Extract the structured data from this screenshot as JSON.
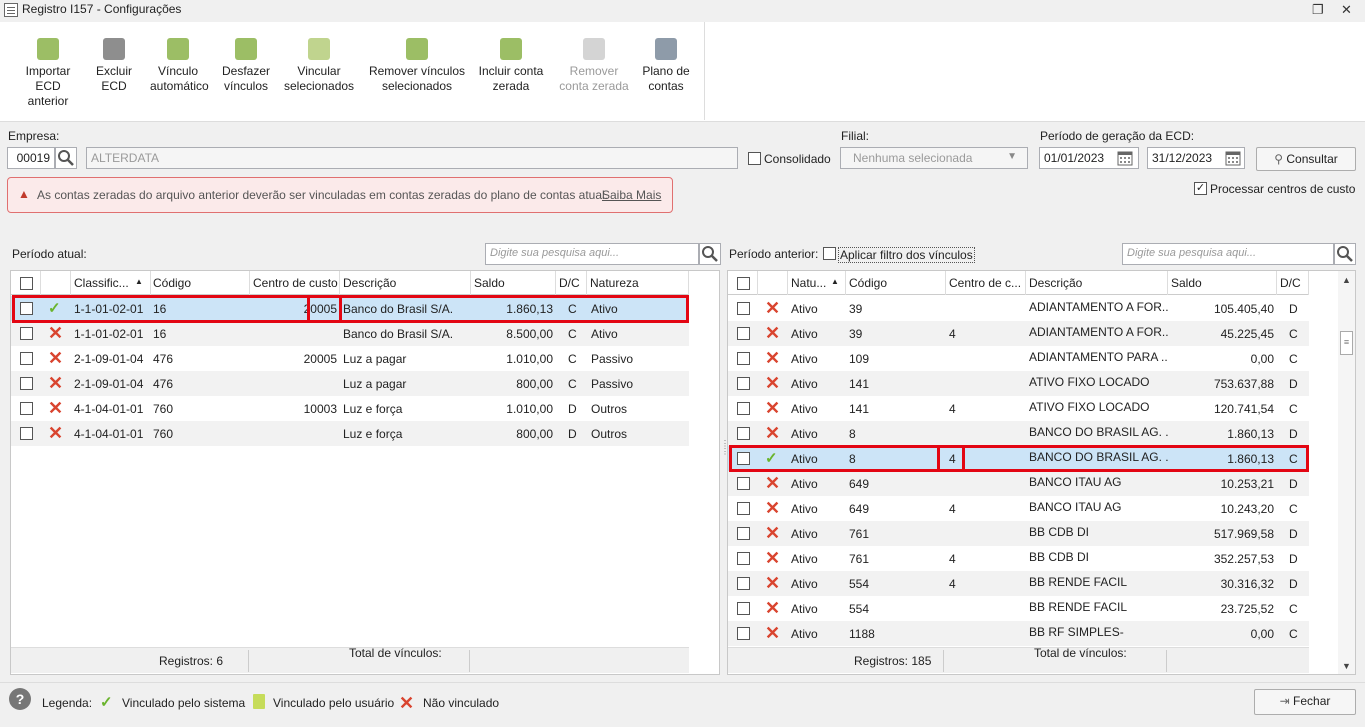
{
  "window": {
    "title": "Registro I157 - Configurações"
  },
  "ribbon": [
    {
      "label1": "Importar",
      "label2": "ECD anterior",
      "icon": "import-icon",
      "disabled": false
    },
    {
      "label1": "Excluir",
      "label2": "ECD",
      "icon": "trash-icon",
      "disabled": false
    },
    {
      "label1": "Vínculo",
      "label2": "automático",
      "icon": "auto-link-icon",
      "disabled": false
    },
    {
      "label1": "Desfazer",
      "label2": "vínculos",
      "icon": "undo-link-icon",
      "disabled": false
    },
    {
      "label1": "Vincular",
      "label2": "selecionados",
      "icon": "link-selected-icon",
      "disabled": false
    },
    {
      "label1": "Remover vínculos",
      "label2": "selecionados",
      "icon": "remove-links-icon",
      "disabled": false
    },
    {
      "label1": "Incluir conta",
      "label2": "zerada",
      "icon": "add-account-icon",
      "disabled": false
    },
    {
      "label1": "Remover",
      "label2": "conta zerada",
      "icon": "remove-account-icon",
      "disabled": true
    },
    {
      "label1": "Plano de",
      "label2": "contas",
      "icon": "chart-accounts-icon",
      "disabled": false
    }
  ],
  "form": {
    "empresa_label": "Empresa:",
    "empresa_code": "00019",
    "empresa_name": "ALTERDATA",
    "consolidado_label": "Consolidado",
    "filial_label": "Filial:",
    "filial_value": "Nenhuma selecionada",
    "periodo_label": "Período de geração da ECD:",
    "date_start": "01/01/2023",
    "date_end": "31/12/2023",
    "consultar_label": "Consultar",
    "processar_label": "Processar centros de custo"
  },
  "alert": {
    "text": "As contas zeradas do arquivo anterior deverão ser vinculadas em contas zeradas do plano de contas atual.",
    "link": "Saiba Mais"
  },
  "left": {
    "title": "Período atual:",
    "search_placeholder": "Digite sua pesquisa aqui...",
    "headers": [
      "Classific...",
      "Código",
      "Centro de custo",
      "Descrição",
      "Saldo",
      "D/C",
      "Natureza"
    ],
    "rows": [
      {
        "status": "v",
        "classif": "1-1-01-02-01",
        "codigo": "16",
        "centro": "20005",
        "descricao": "Banco do Brasil S/A.",
        "saldo": "1.860,13",
        "dc": "C",
        "natureza": "Ativo"
      },
      {
        "status": "x",
        "classif": "1-1-01-02-01",
        "codigo": "16",
        "centro": "",
        "descricao": "Banco do Brasil S/A.",
        "saldo": "8.500,00",
        "dc": "C",
        "natureza": "Ativo"
      },
      {
        "status": "x",
        "classif": "2-1-09-01-04",
        "codigo": "476",
        "centro": "20005",
        "descricao": "Luz a pagar",
        "saldo": "1.010,00",
        "dc": "C",
        "natureza": "Passivo"
      },
      {
        "status": "x",
        "classif": "2-1-09-01-04",
        "codigo": "476",
        "centro": "",
        "descricao": "Luz a pagar",
        "saldo": "800,00",
        "dc": "C",
        "natureza": "Passivo"
      },
      {
        "status": "x",
        "classif": "4-1-04-01-01",
        "codigo": "760",
        "centro": "10003",
        "descricao": "Luz e força",
        "saldo": "1.010,00",
        "dc": "D",
        "natureza": "Outros"
      },
      {
        "status": "x",
        "classif": "4-1-04-01-01",
        "codigo": "760",
        "centro": "",
        "descricao": "Luz e força",
        "saldo": "800,00",
        "dc": "D",
        "natureza": "Outros"
      }
    ],
    "registros": "Registros: 6",
    "total_vinculos": "Total de vínculos:"
  },
  "right": {
    "title": "Período anterior:",
    "filter_label": "Aplicar filtro dos vínculos",
    "search_placeholder": "Digite sua pesquisa aqui...",
    "headers": [
      "Natu...",
      "Código",
      "Centro de c...",
      "Descrição",
      "Saldo",
      "D/C"
    ],
    "rows": [
      {
        "status": "x",
        "natureza": "Ativo",
        "codigo": "39",
        "centro": "",
        "descricao": "ADIANTAMENTO A FOR...",
        "saldo": "105.405,40",
        "dc": "D"
      },
      {
        "status": "x",
        "natureza": "Ativo",
        "codigo": "39",
        "centro": "4",
        "descricao": "ADIANTAMENTO A FOR...",
        "saldo": "45.225,45",
        "dc": "C"
      },
      {
        "status": "x",
        "natureza": "Ativo",
        "codigo": "109",
        "centro": "",
        "descricao": "ADIANTAMENTO PARA ...",
        "saldo": "0,00",
        "dc": "C"
      },
      {
        "status": "x",
        "natureza": "Ativo",
        "codigo": "141",
        "centro": "",
        "descricao": "ATIVO FIXO LOCADO",
        "saldo": "753.637,88",
        "dc": "D"
      },
      {
        "status": "x",
        "natureza": "Ativo",
        "codigo": "141",
        "centro": "4",
        "descricao": "ATIVO FIXO LOCADO",
        "saldo": "120.741,54",
        "dc": "C"
      },
      {
        "status": "x",
        "natureza": "Ativo",
        "codigo": "8",
        "centro": "",
        "descricao": "BANCO DO BRASIL AG. ...",
        "saldo": "1.860,13",
        "dc": "D"
      },
      {
        "status": "v",
        "natureza": "Ativo",
        "codigo": "8",
        "centro": "4",
        "descricao": "BANCO DO BRASIL AG. ...",
        "saldo": "1.860,13",
        "dc": "C"
      },
      {
        "status": "x",
        "natureza": "Ativo",
        "codigo": "649",
        "centro": "",
        "descricao": "BANCO ITAU AG",
        "saldo": "10.253,21",
        "dc": "D"
      },
      {
        "status": "x",
        "natureza": "Ativo",
        "codigo": "649",
        "centro": "4",
        "descricao": "BANCO ITAU AG",
        "saldo": "10.243,20",
        "dc": "C"
      },
      {
        "status": "x",
        "natureza": "Ativo",
        "codigo": "761",
        "centro": "",
        "descricao": "BB CDB DI",
        "saldo": "517.969,58",
        "dc": "D"
      },
      {
        "status": "x",
        "natureza": "Ativo",
        "codigo": "761",
        "centro": "4",
        "descricao": "BB CDB DI",
        "saldo": "352.257,53",
        "dc": "D"
      },
      {
        "status": "x",
        "natureza": "Ativo",
        "codigo": "554",
        "centro": "4",
        "descricao": "BB RENDE FACIL",
        "saldo": "30.316,32",
        "dc": "D"
      },
      {
        "status": "x",
        "natureza": "Ativo",
        "codigo": "554",
        "centro": "",
        "descricao": "BB RENDE FACIL",
        "saldo": "23.725,52",
        "dc": "C"
      },
      {
        "status": "x",
        "natureza": "Ativo",
        "codigo": "1188",
        "centro": "",
        "descricao": "BB RF SIMPLES-",
        "saldo": "0,00",
        "dc": "C"
      }
    ],
    "registros": "Registros: 185",
    "total_vinculos": "Total de vínculos:"
  },
  "legend": {
    "label": "Legenda:",
    "sistema": "Vinculado pelo sistema",
    "usuario": "Vinculado pelo usuário",
    "nao": "Não vinculado"
  },
  "fechar_label": "Fechar"
}
